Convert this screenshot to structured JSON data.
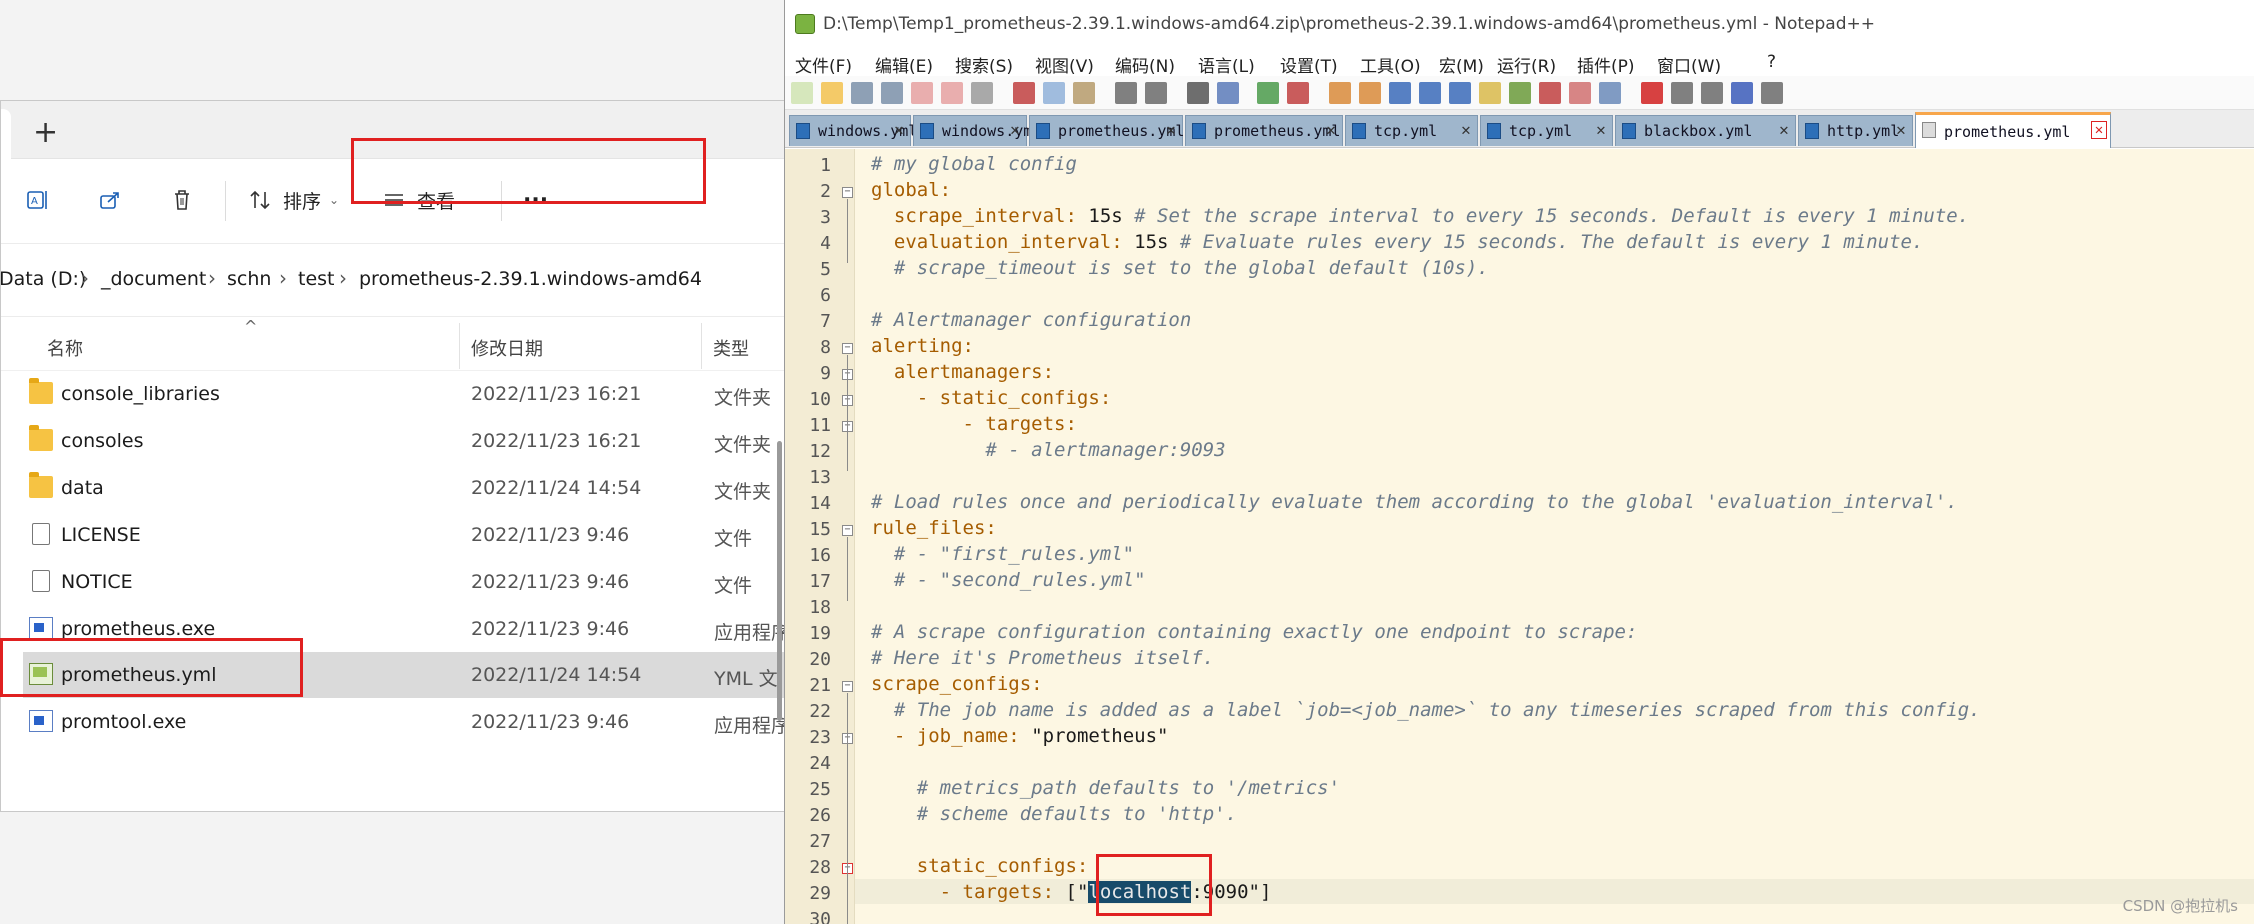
{
  "explorer": {
    "new_tab": "+",
    "toolbar": {
      "sort_label": "排序",
      "view_label": "查看",
      "more_label": "···"
    },
    "breadcrumb": {
      "drive": "Data (D:)",
      "items": [
        "_document",
        "schn",
        "test"
      ],
      "current": "prometheus-2.39.1.windows-amd64"
    },
    "columns": {
      "name": "名称",
      "date": "修改日期",
      "type": "类型"
    },
    "rows": [
      {
        "name": "console_libraries",
        "date": "2022/11/23 16:21",
        "type": "文件夹",
        "icon": "folder-icon"
      },
      {
        "name": "consoles",
        "date": "2022/11/23 16:21",
        "type": "文件夹",
        "icon": "folder-icon"
      },
      {
        "name": "data",
        "date": "2022/11/24 14:54",
        "type": "文件夹",
        "icon": "folder-icon"
      },
      {
        "name": "LICENSE",
        "date": "2022/11/23 9:46",
        "type": "文件",
        "icon": "file-icon"
      },
      {
        "name": "NOTICE",
        "date": "2022/11/23 9:46",
        "type": "文件",
        "icon": "file-icon"
      },
      {
        "name": "prometheus.exe",
        "date": "2022/11/23 9:46",
        "type": "应用程序",
        "icon": "exe-icon"
      },
      {
        "name": "prometheus.yml",
        "date": "2022/11/24 14:54",
        "type": "YML 文",
        "icon": "yml-icon",
        "selected": true
      },
      {
        "name": "promtool.exe",
        "date": "2022/11/23 9:46",
        "type": "应用程序",
        "icon": "exe-icon"
      }
    ]
  },
  "notepad": {
    "title": "D:\\Temp\\Temp1_prometheus-2.39.1.windows-amd64.zip\\prometheus-2.39.1.windows-amd64\\prometheus.yml - Notepad++",
    "menu": [
      "文件(F)",
      "编辑(E)",
      "搜索(S)",
      "视图(V)",
      "编码(N)",
      "语言(L)",
      "设置(T)",
      "工具(O)",
      "宏(M)",
      "运行(R)",
      "插件(P)",
      "窗口(W)",
      "?"
    ],
    "tabs": [
      "windows.yml",
      "windows.yml",
      "prometheus.yml",
      "prometheus.yml",
      "tcp.yml",
      "tcp.yml",
      "blackbox.yml",
      "http.yml",
      "prometheus.yml"
    ],
    "active_tab": 8,
    "lines": [
      "# my global config",
      "global:",
      "  scrape_interval: 15s # Set the scrape interval to every 15 seconds. Default is every 1 minute.",
      "  evaluation_interval: 15s # Evaluate rules every 15 seconds. The default is every 1 minute.",
      "  # scrape_timeout is set to the global default (10s).",
      "",
      "# Alertmanager configuration",
      "alerting:",
      "  alertmanagers:",
      "    - static_configs:",
      "        - targets:",
      "          # - alertmanager:9093",
      "",
      "# Load rules once and periodically evaluate them according to the global 'evaluation_interval'.",
      "rule_files:",
      "  # - \"first_rules.yml\"",
      "  # - \"second_rules.yml\"",
      "",
      "# A scrape configuration containing exactly one endpoint to scrape:",
      "# Here it's Prometheus itself.",
      "scrape_configs:",
      "  # The job name is added as a label `job=<job_name>` to any timeseries scraped from this config.",
      "  - job_name: \"prometheus\"",
      "",
      "    # metrics_path defaults to '/metrics'",
      "    # scheme defaults to 'http'.",
      "",
      "    static_configs:",
      "      - targets: [\"localhost:9090\"]",
      ""
    ],
    "highlighted_text": "localhost"
  },
  "watermark": "CSDN @抱拉机s"
}
